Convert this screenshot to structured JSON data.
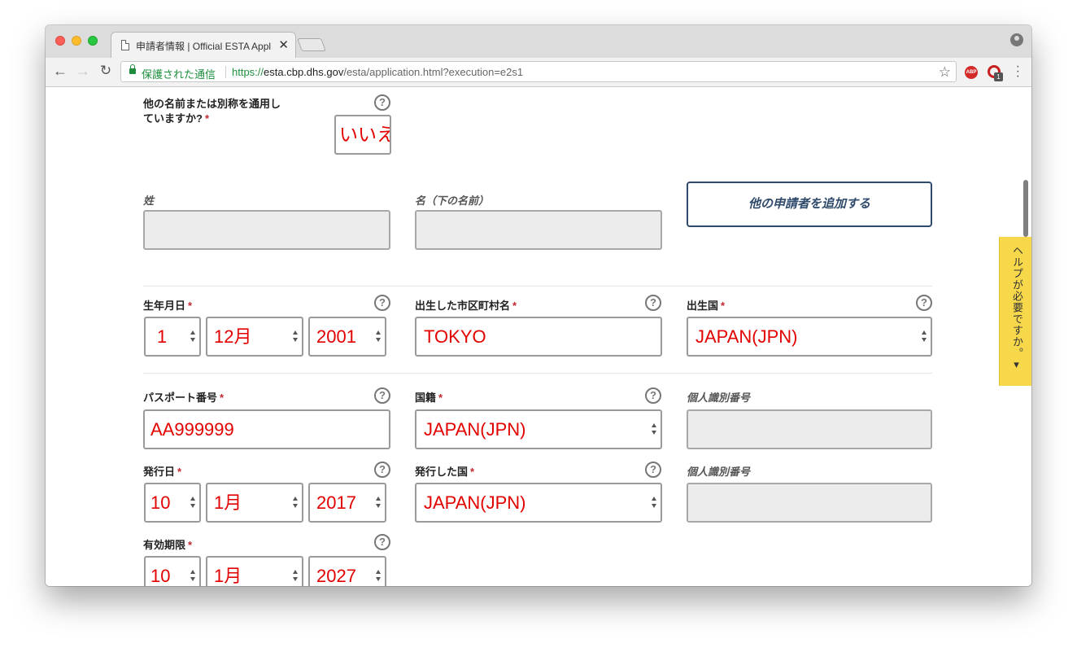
{
  "browser": {
    "tab_title": "申請者情報 | Official ESTA Appl",
    "tab_close": "✕",
    "secure_label": "保護された通信",
    "url_scheme": "https://",
    "url_host": "esta.cbp.dhs.gov",
    "url_path": "/esta/application.html?execution=e2s1",
    "abp_label": "ABP",
    "ext_badge": "1"
  },
  "form": {
    "alias_question_line1": "他の名前または別称を通用し",
    "alias_question_line2": "ていますか?",
    "alias_answer": "いいえ",
    "surname_label": "姓",
    "given_name_label": "名（下の名前）",
    "add_applicant_button": "他の申請者を追加する",
    "birth_date_label": "生年月日",
    "birth_day": "1",
    "birth_month": "12月",
    "birth_year": "2001",
    "birth_city_label": "出生した市区町村名",
    "birth_city": "TOKYO",
    "birth_country_label": "出生国",
    "birth_country": "JAPAN(JPN)",
    "passport_label": "パスポート番号",
    "passport_number": "AA999999",
    "nationality_label": "国籍",
    "nationality": "JAPAN(JPN)",
    "personal_id_label": "個人識別番号",
    "issue_date_label": "発行日",
    "issue_day": "10",
    "issue_month": "1月",
    "issue_year": "2017",
    "issuing_country_label": "発行した国",
    "issuing_country": "JAPAN(JPN)",
    "personal_id_label_2": "個人識別番号",
    "expiry_label": "有効期限",
    "expiry_day": "10",
    "expiry_month": "1月",
    "expiry_year": "2027",
    "required_mark": "*",
    "help_mark": "?"
  },
  "help_tab": "ヘルプが必要ですか。▾"
}
